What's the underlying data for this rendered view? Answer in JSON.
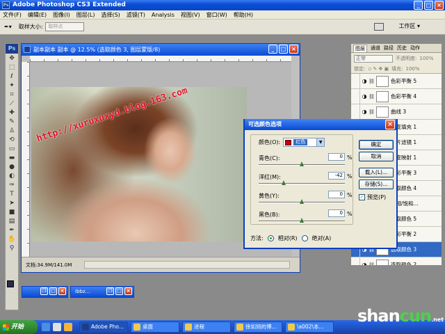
{
  "app": {
    "title": "Adobe Photoshop CS3 Extended"
  },
  "menu": [
    "文件(F)",
    "编辑(E)",
    "图像(I)",
    "图层(L)",
    "选择(S)",
    "滤镜(T)",
    "Analysis",
    "视图(V)",
    "窗口(W)",
    "帮助(H)"
  ],
  "options": {
    "sample_label": "取样大小:",
    "sample_value": "取样点",
    "workspace": "工作区 ▾"
  },
  "document": {
    "title": "副本副本 副本 @ 12.5% (选取颜色 3, 图层蒙版/8)",
    "status": "文档:34.9M/141.0M",
    "watermark": "http://xuruxuxyd.blog.163.com"
  },
  "layers_panel": {
    "tabs": [
      "图层",
      "通道",
      "路径",
      "历史",
      "动作"
    ],
    "blend_mode": "正常",
    "opacity_label": "不透明度:",
    "opacity": "100%",
    "lock_label": "锁定:",
    "fill_label": "填充:",
    "fill": "100%",
    "items": [
      {
        "name": "色彩平衡 5",
        "selected": false
      },
      {
        "name": "色彩平衡 4",
        "selected": false
      },
      {
        "name": "曲线 3",
        "selected": false
      },
      {
        "name": "渐变填充 1",
        "selected": false
      },
      {
        "name": "照片滤镜 1",
        "selected": false
      },
      {
        "name": "渐变映射 1",
        "selected": false
      },
      {
        "name": "色彩平衡 3",
        "selected": false
      },
      {
        "name": "选取颜色 4",
        "selected": false
      },
      {
        "name": "色相/饱和...",
        "selected": false
      },
      {
        "name": "选取颜色 5",
        "selected": false
      },
      {
        "name": "色彩平衡 2",
        "selected": false
      },
      {
        "name": "选取颜色 3",
        "selected": true
      },
      {
        "name": "选取颜色 2",
        "selected": false
      }
    ]
  },
  "dialog": {
    "title": "可选颜色选项",
    "color_label": "颜色(O):",
    "color_value": "红色",
    "sliders": [
      {
        "label": "青色(C):",
        "value": "0",
        "pct": "%",
        "position": 0.5
      },
      {
        "label": "洋红(M):",
        "value": "-42",
        "pct": "%",
        "position": 0.29
      },
      {
        "label": "黄色(Y):",
        "value": "0",
        "pct": "%",
        "position": 0.5
      },
      {
        "label": "黑色(B):",
        "value": "0",
        "pct": "%",
        "position": 0.5
      }
    ],
    "buttons": {
      "ok": "确定",
      "cancel": "取消",
      "load": "载入(L)...",
      "save": "存储(S)..."
    },
    "preview_label": "预览(P)",
    "method_label": "方法:",
    "method_relative": "相对(R)",
    "method_absolute": "绝对(A)"
  },
  "minimized": [
    "",
    "Ibbz..."
  ],
  "taskbar": {
    "start": "开始",
    "tasks": [
      "Adobe Pho...",
      "桌面",
      "进程",
      "徐如旭的博...",
      "\\a002\\本..."
    ]
  },
  "site_watermark": {
    "text_a": "shan",
    "text_b": "cun",
    "suffix": ".net"
  }
}
